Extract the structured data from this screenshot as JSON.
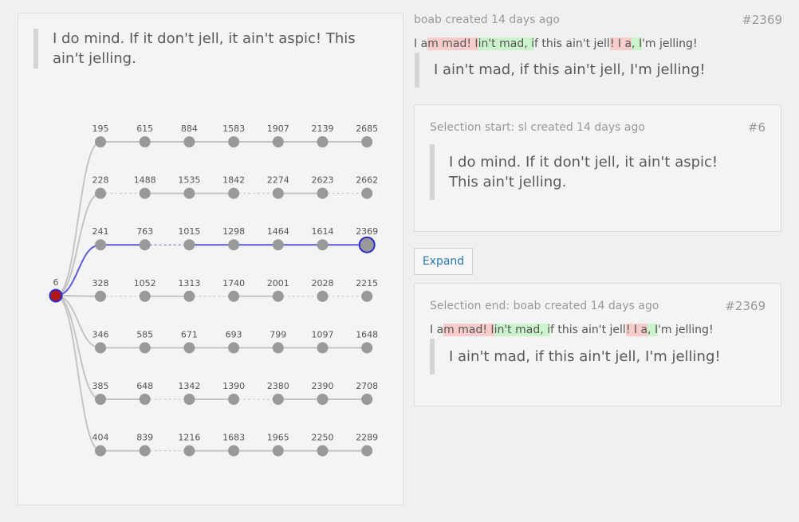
{
  "left_panel": {
    "quote": "I do mind. If it don't jell, it ain't aspic! This ain't jelling."
  },
  "graph": {
    "root_label": "6",
    "rows": [
      {
        "labels": [
          "195",
          "615",
          "884",
          "1583",
          "1907",
          "2139",
          "2685"
        ],
        "edges": [
          "solid",
          "solid",
          "solid",
          "solid",
          "solid",
          "solid"
        ]
      },
      {
        "labels": [
          "228",
          "1488",
          "1535",
          "1842",
          "2274",
          "2623",
          "2662"
        ],
        "edges": [
          "dashed",
          "solid",
          "solid",
          "dashed",
          "solid",
          "dashed"
        ]
      },
      {
        "labels": [
          "241",
          "763",
          "1015",
          "1298",
          "1464",
          "1614",
          "2369"
        ],
        "edges": [
          "solid",
          "dashed",
          "solid",
          "solid",
          "solid",
          "solid"
        ],
        "highlighted": true
      },
      {
        "labels": [
          "328",
          "1052",
          "1313",
          "1740",
          "2001",
          "2028",
          "2215"
        ],
        "edges": [
          "dashed",
          "solid",
          "dashed",
          "solid",
          "dashed",
          "dashed"
        ]
      },
      {
        "labels": [
          "346",
          "585",
          "671",
          "693",
          "799",
          "1097",
          "1648"
        ],
        "edges": [
          "solid",
          "solid",
          "solid",
          "solid",
          "solid",
          "solid"
        ]
      },
      {
        "labels": [
          "385",
          "648",
          "1342",
          "1390",
          "2380",
          "2390",
          "2708"
        ],
        "edges": [
          "solid",
          "dashed",
          "solid",
          "dashed",
          "solid",
          "solid"
        ]
      },
      {
        "labels": [
          "404",
          "839",
          "1216",
          "1683",
          "1965",
          "2250",
          "2289"
        ],
        "edges": [
          "solid",
          "dashed",
          "solid",
          "solid",
          "solid",
          "solid"
        ]
      }
    ],
    "colors": {
      "node": "#999999",
      "edge": "#c4c4c4",
      "highlight": "#5b5bdc",
      "root_fill": "#b01818",
      "root_stroke": "#2a2acc"
    }
  },
  "top_comment": {
    "meta": "boab created 14 days ago",
    "number": "#2369",
    "diff": [
      {
        "t": "I a",
        "c": ""
      },
      {
        "t": "m mad! I",
        "c": "del"
      },
      {
        "t": "in't mad, i",
        "c": "ins"
      },
      {
        "t": "f this ain't jell",
        "c": ""
      },
      {
        "t": "! I a",
        "c": "del"
      },
      {
        "t": ", I",
        "c": "ins"
      },
      {
        "t": "'m jelling!",
        "c": ""
      }
    ],
    "quote": "I ain't mad, if this ain't jell, I'm jelling!"
  },
  "selection_start": {
    "meta": "Selection start: sl created 14 days ago",
    "number": "#6",
    "quote": "I do mind. If it don't jell, it ain't aspic! This ain't jelling."
  },
  "expand_label": "Expand",
  "selection_end": {
    "meta": "Selection end: boab created 14 days ago",
    "number": "#2369",
    "diff": [
      {
        "t": "I a",
        "c": ""
      },
      {
        "t": "m mad! I",
        "c": "del"
      },
      {
        "t": "in't mad, i",
        "c": "ins"
      },
      {
        "t": "f this ain't jell",
        "c": ""
      },
      {
        "t": "! I a",
        "c": "del"
      },
      {
        "t": ", I",
        "c": "ins"
      },
      {
        "t": "'m jelling!",
        "c": ""
      }
    ],
    "quote": "I ain't mad, if this ain't jell, I'm jelling!"
  }
}
